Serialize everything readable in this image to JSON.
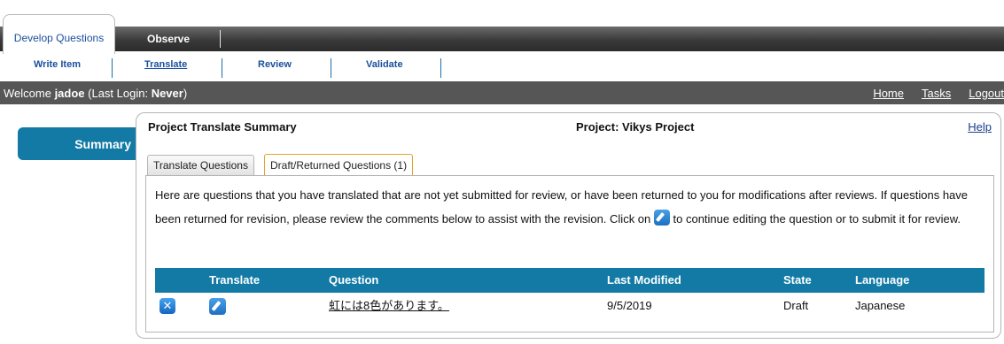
{
  "top_tabs": {
    "active": "Develop Questions",
    "other": "Observe"
  },
  "sub_tabs": [
    {
      "label": "Write Item"
    },
    {
      "label": "Translate"
    },
    {
      "label": "Review"
    },
    {
      "label": "Validate"
    }
  ],
  "welcome": {
    "prefix": "Welcome ",
    "user": "jadoe",
    "login_prefix": " (Last Login: ",
    "login_value": "Never",
    "login_suffix": ")",
    "links": {
      "home": "Home",
      "tasks": "Tasks",
      "logout": "Logout"
    }
  },
  "sidebar": {
    "summary": "Summary"
  },
  "panel": {
    "title": "Project Translate Summary",
    "project": "Project: Vikys Project",
    "help": "Help",
    "tabs": [
      "Translate Questions",
      "Draft/Returned Questions (1)"
    ],
    "description_1": "Here are questions that you have translated that are not yet submitted for review, or have been returned to you for modifications after reviews. If questions have been returned for revision, please review the comments below to assist with the revision. Click on",
    "description_2": "to continue editing the question or to submit it for review."
  },
  "table": {
    "headers": [
      "Translate",
      "Question",
      "Last Modified",
      "State",
      "Language"
    ],
    "rows": [
      {
        "question": "虹には8色があります。",
        "last_modified": "9/5/2019",
        "state": "Draft",
        "language": "Japanese"
      }
    ]
  },
  "icons": {
    "delete": "delete-icon",
    "edit": "edit-pencil-icon"
  },
  "colors": {
    "accent": "#127aa5",
    "header_bar": "#565656",
    "tab_bar": "#3a3a3a",
    "selected_tab_border": "#e1a52a"
  }
}
